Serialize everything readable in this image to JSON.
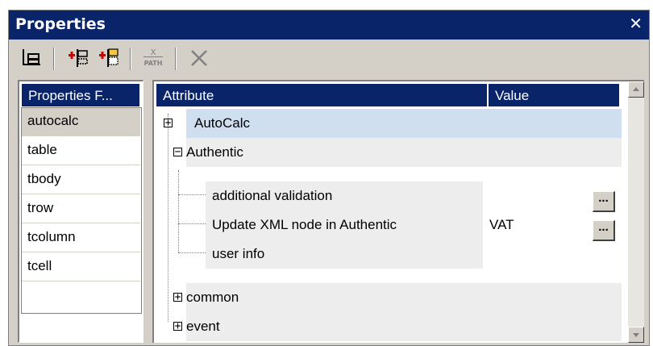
{
  "window": {
    "title": "Properties",
    "close_glyph": "✕"
  },
  "toolbar": {
    "buttons": [
      {
        "name": "tree-view-icon"
      },
      {
        "name": "add-attribute-icon"
      },
      {
        "name": "add-attribute-group-icon"
      },
      {
        "name": "xpath-icon",
        "label": "PATH"
      },
      {
        "name": "delete-icon"
      }
    ]
  },
  "left_panel": {
    "header": "Properties F...",
    "items": [
      "autocalc",
      "table",
      "tbody",
      "trow",
      "tcolumn",
      "tcell"
    ],
    "selected": "autocalc"
  },
  "grid": {
    "columns": {
      "attribute": "Attribute",
      "value": "Value"
    },
    "rows": [
      {
        "label": "AutoCalc",
        "expander": "+",
        "value": ""
      },
      {
        "label": "Authentic",
        "expander": "−",
        "value": ""
      },
      {
        "label": "additional validation",
        "value": "",
        "has_button": true,
        "button_label": "..."
      },
      {
        "label": "Update XML node in Authentic",
        "value": "VAT",
        "has_button": true,
        "button_label": "..."
      },
      {
        "label": "user info",
        "value": ""
      },
      {
        "label": "common",
        "expander": "+",
        "value": ""
      },
      {
        "label": "event",
        "expander": "+",
        "value": ""
      }
    ]
  },
  "colors": {
    "header_bg": "#0a246a",
    "selected_row": "#cfdff0",
    "chrome": "#d4d0c8"
  }
}
